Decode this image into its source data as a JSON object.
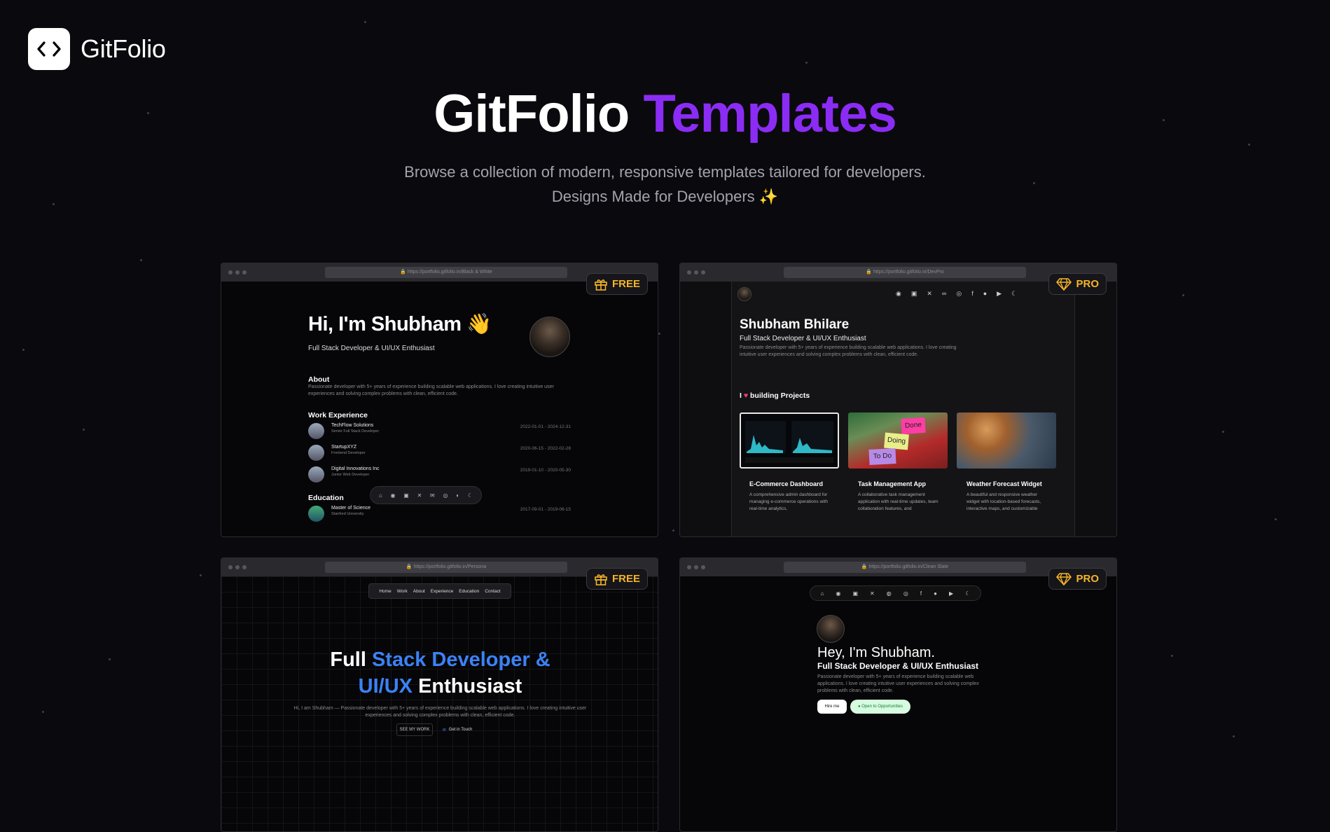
{
  "brand": {
    "name": "GitFolio",
    "logo_icon": "code-brackets-icon"
  },
  "hero": {
    "title_main": "GitFolio",
    "title_accent": "Templates",
    "accent_color": "#8b2cf5",
    "subtitle_line1": "Browse a collection of modern, responsive templates tailored for developers.",
    "subtitle_line2": "Designs Made for Developers ✨"
  },
  "templates": [
    {
      "tier": "FREE",
      "url": "https://portfolio.gitfolio.in/Black & White",
      "name_heading": "Hi, I'm Shubham 👋",
      "tagline": "Full Stack Developer & UI/UX Enthusiast",
      "about_title": "About",
      "about_text": "Passionate developer with 5+ years of experience building scalable web applications. I love creating intuitive user experiences and solving complex problems with clean, efficient code.",
      "work_title": "Work Experience",
      "experience": [
        {
          "company": "TechFlow Solutions",
          "role": "Senior Full Stack Developer",
          "dates": "2022-01-01 - 2024-12-31"
        },
        {
          "company": "StartupXYZ",
          "role": "Frontend Developer",
          "dates": "2020-06-15 - 2022-02-28"
        },
        {
          "company": "Digital Innovations Inc",
          "role": "Junior Web Developer",
          "dates": "2019-01-10 - 2020-05-30"
        }
      ],
      "education_title": "Education",
      "education": {
        "degree": "Master of Science",
        "school": "Stanford University",
        "dates": "2017-09-01 - 2019-06-15"
      }
    },
    {
      "tier": "PRO",
      "url": "https://portfolio.gitfolio.in/DevPro",
      "name": "Shubham Bhilare",
      "tagline": "Full Stack Developer & UI/UX Enthusiast",
      "bio": "Passionate developer with 5+ years of experience building scalable web applications. I love creating intuitive user experiences and solving complex problems with clean, efficient code.",
      "projects_heading_pre": "I",
      "projects_heading_post": "building Projects",
      "projects": [
        {
          "title": "E-Commerce Dashboard",
          "desc": "A comprehensive admin dashboard for managing e-commerce operations with real-time analytics,"
        },
        {
          "title": "Task Management App",
          "desc": "A collaborative task management application with real-time updates, team collaboration features, and"
        },
        {
          "title": "Weather Forecast Widget",
          "desc": "A beautiful and responsive weather widget with location-based forecasts, interactive maps, and customizable"
        }
      ],
      "sticky_notes": [
        "Done",
        "Doing",
        "To Do"
      ]
    },
    {
      "tier": "FREE",
      "url": "https://portfolio.gitfolio.in/Persona",
      "nav": [
        "Home",
        "Work",
        "About",
        "Experience",
        "Education",
        "Contact"
      ],
      "headline_a": "Full",
      "headline_b": "Stack Developer &",
      "headline_c": "UI/UX",
      "headline_d": "Enthusiast",
      "intro": "Hi, I am Shubham — Passionate developer with 5+ years of experience building scalable web applications. I love creating intuitive user experiences and solving complex problems with clean, efficient code.",
      "see_work": "SEE MY WORK",
      "contact": "Get in Touch"
    },
    {
      "tier": "PRO",
      "url": "https://portfolio.gitfolio.in/Clean Slate",
      "greeting": "Hey, I'm Shubham.",
      "tagline": "Full Stack Developer & UI/UX Enthusiast",
      "bio": "Passionate developer with 5+ years of experience building scalable web applications. I love creating intuitive user experiences and solving complex problems with clean, efficient code.",
      "hire_btn": "Hire me",
      "status_pill": "● Open to Opportunities"
    }
  ]
}
